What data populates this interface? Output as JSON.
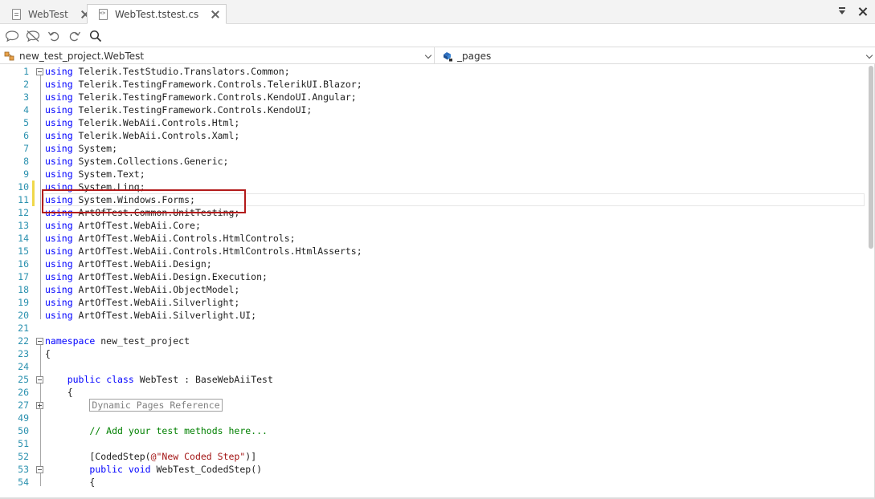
{
  "tabs": [
    {
      "label": "WebTest",
      "icon": "file-icon",
      "active": false
    },
    {
      "label": "WebTest.tstest.cs",
      "icon": "code-file-icon",
      "active": true
    }
  ],
  "toolbar": {
    "icons": [
      "comment-icon",
      "uncomment-icon",
      "undo-icon",
      "redo-icon",
      "search-icon"
    ]
  },
  "navbar": {
    "class_combo": "new_test_project.WebTest",
    "member_combo": "_pages"
  },
  "colors": {
    "keyword": "#0000ff",
    "comment": "#008000",
    "string": "#a31515",
    "line_number": "#2b91af",
    "highlight_box": "#b31b1b"
  },
  "code_lines": [
    {
      "n": "1",
      "parts": [
        [
          "kw",
          "using"
        ],
        [
          "",
          " Telerik.TestStudio.Translators.Common;"
        ]
      ]
    },
    {
      "n": "2",
      "parts": [
        [
          "kw",
          "using"
        ],
        [
          "",
          " Telerik.TestingFramework.Controls.TelerikUI.Blazor;"
        ]
      ]
    },
    {
      "n": "3",
      "parts": [
        [
          "kw",
          "using"
        ],
        [
          "",
          " Telerik.TestingFramework.Controls.KendoUI.Angular;"
        ]
      ]
    },
    {
      "n": "4",
      "parts": [
        [
          "kw",
          "using"
        ],
        [
          "",
          " Telerik.TestingFramework.Controls.KendoUI;"
        ]
      ]
    },
    {
      "n": "5",
      "parts": [
        [
          "kw",
          "using"
        ],
        [
          "",
          " Telerik.WebAii.Controls.Html;"
        ]
      ]
    },
    {
      "n": "6",
      "parts": [
        [
          "kw",
          "using"
        ],
        [
          "",
          " Telerik.WebAii.Controls.Xaml;"
        ]
      ]
    },
    {
      "n": "7",
      "parts": [
        [
          "kw",
          "using"
        ],
        [
          "",
          " System;"
        ]
      ]
    },
    {
      "n": "8",
      "parts": [
        [
          "kw",
          "using"
        ],
        [
          "",
          " System.Collections.Generic;"
        ]
      ]
    },
    {
      "n": "9",
      "parts": [
        [
          "kw",
          "using"
        ],
        [
          "",
          " System.Text;"
        ]
      ]
    },
    {
      "n": "10",
      "parts": [
        [
          "kw",
          "using"
        ],
        [
          "",
          " System.Linq;"
        ]
      ]
    },
    {
      "n": "11",
      "parts": [
        [
          "kw",
          "using"
        ],
        [
          "",
          " System.Windows.Forms;"
        ]
      ]
    },
    {
      "n": "12",
      "parts": [
        [
          "kw",
          "using"
        ],
        [
          "",
          " ArtOfTest.Common.UnitTesting;"
        ]
      ]
    },
    {
      "n": "13",
      "parts": [
        [
          "kw",
          "using"
        ],
        [
          "",
          " ArtOfTest.WebAii.Core;"
        ]
      ]
    },
    {
      "n": "14",
      "parts": [
        [
          "kw",
          "using"
        ],
        [
          "",
          " ArtOfTest.WebAii.Controls.HtmlControls;"
        ]
      ]
    },
    {
      "n": "15",
      "parts": [
        [
          "kw",
          "using"
        ],
        [
          "",
          " ArtOfTest.WebAii.Controls.HtmlControls.HtmlAsserts;"
        ]
      ]
    },
    {
      "n": "16",
      "parts": [
        [
          "kw",
          "using"
        ],
        [
          "",
          " ArtOfTest.WebAii.Design;"
        ]
      ]
    },
    {
      "n": "17",
      "parts": [
        [
          "kw",
          "using"
        ],
        [
          "",
          " ArtOfTest.WebAii.Design.Execution;"
        ]
      ]
    },
    {
      "n": "18",
      "parts": [
        [
          "kw",
          "using"
        ],
        [
          "",
          " ArtOfTest.WebAii.ObjectModel;"
        ]
      ]
    },
    {
      "n": "19",
      "parts": [
        [
          "kw",
          "using"
        ],
        [
          "",
          " ArtOfTest.WebAii.Silverlight;"
        ]
      ]
    },
    {
      "n": "20",
      "parts": [
        [
          "kw",
          "using"
        ],
        [
          "",
          " ArtOfTest.WebAii.Silverlight.UI;"
        ]
      ]
    },
    {
      "n": "21",
      "parts": []
    },
    {
      "n": "22",
      "parts": [
        [
          "kw",
          "namespace"
        ],
        [
          "",
          " new_test_project"
        ]
      ]
    },
    {
      "n": "23",
      "parts": [
        [
          "",
          "{"
        ]
      ]
    },
    {
      "n": "24",
      "parts": []
    },
    {
      "n": "25",
      "parts": [
        [
          "",
          "    "
        ],
        [
          "kw",
          "public"
        ],
        [
          "",
          " "
        ],
        [
          "kw",
          "class"
        ],
        [
          "",
          " WebTest : BaseWebAiiTest"
        ]
      ]
    },
    {
      "n": "26",
      "parts": [
        [
          "",
          "    {"
        ]
      ]
    },
    {
      "n": "27",
      "parts": [
        [
          "",
          "        "
        ],
        [
          "region",
          "Dynamic Pages Reference"
        ]
      ]
    },
    {
      "n": "49",
      "parts": []
    },
    {
      "n": "50",
      "parts": [
        [
          "",
          "        "
        ],
        [
          "cm",
          "// Add your test methods here..."
        ]
      ]
    },
    {
      "n": "51",
      "parts": []
    },
    {
      "n": "52",
      "parts": [
        [
          "",
          "        [CodedStep("
        ],
        [
          "str",
          "@\"New Coded Step\""
        ],
        [
          "",
          ")]"
        ]
      ]
    },
    {
      "n": "53",
      "parts": [
        [
          "",
          "        "
        ],
        [
          "kw",
          "public"
        ],
        [
          "",
          " "
        ],
        [
          "kw",
          "void"
        ],
        [
          "",
          " WebTest_CodedStep()"
        ]
      ]
    },
    {
      "n": "54",
      "parts": [
        [
          "",
          "        {"
        ]
      ]
    }
  ]
}
